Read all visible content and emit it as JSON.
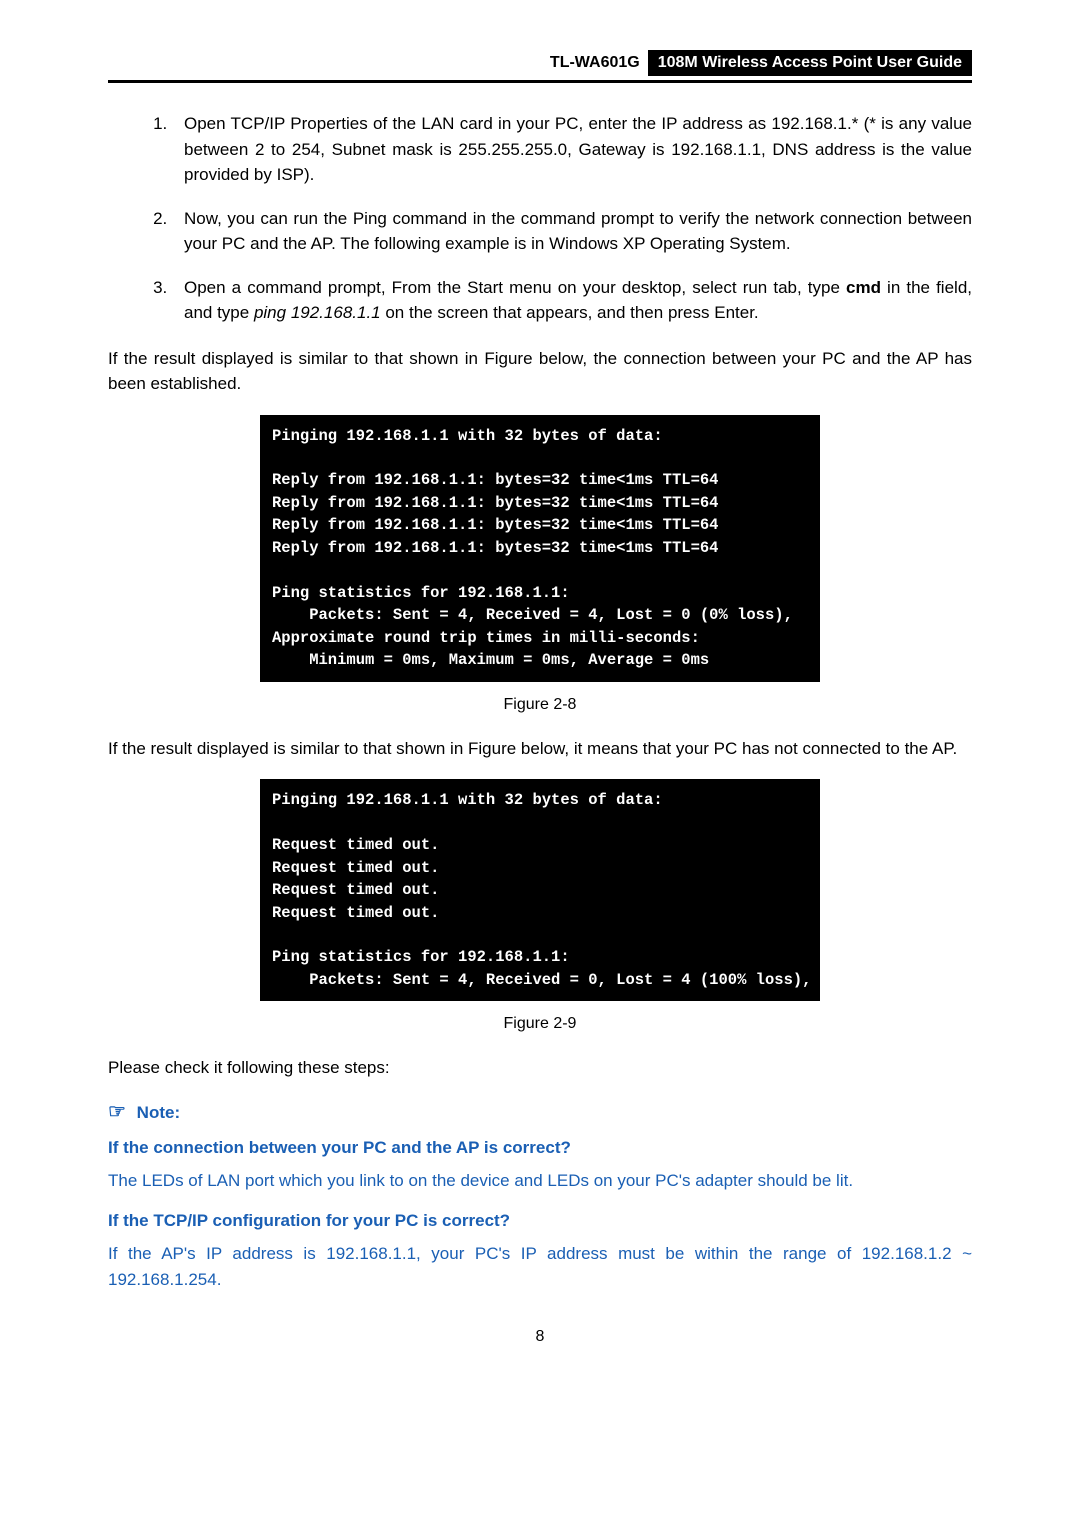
{
  "header": {
    "model": "TL-WA601G",
    "title": "108M Wireless Access Point User Guide"
  },
  "steps": {
    "s1_a": "Open TCP/IP Properties of the LAN card in your PC, enter the IP address as 192.168.1.* (* is any value between 2 to 254, Subnet mask is 255.255.255.0, Gateway is 192.168.1.1, DNS address is the value provided by ISP).",
    "s2": "Now, you can run the Ping command in the command prompt to verify the network connection between your PC and the AP. The following example is in Windows XP Operating System.",
    "s3_a": "Open a command prompt, From the Start menu on your desktop, select run tab, type ",
    "s3_cmd": "cmd",
    "s3_b": " in the field, and type ",
    "s3_ping": "ping 192.168.1.1",
    "s3_c": " on the screen that appears, and then press Enter."
  },
  "para1": "If the result displayed is similar to that shown in Figure below, the connection between your PC and the AP has been established.",
  "terminal1": "Pinging 192.168.1.1 with 32 bytes of data:\n\nReply from 192.168.1.1: bytes=32 time<1ms TTL=64\nReply from 192.168.1.1: bytes=32 time<1ms TTL=64\nReply from 192.168.1.1: bytes=32 time<1ms TTL=64\nReply from 192.168.1.1: bytes=32 time<1ms TTL=64\n\nPing statistics for 192.168.1.1:\n    Packets: Sent = 4, Received = 4, Lost = 0 (0% loss),\nApproximate round trip times in milli-seconds:\n    Minimum = 0ms, Maximum = 0ms, Average = 0ms",
  "fig1": "Figure 2-8",
  "para2": "If the result displayed is similar to that shown in Figure below, it means that your PC has not connected to the AP.",
  "terminal2": "Pinging 192.168.1.1 with 32 bytes of data:\n\nRequest timed out.\nRequest timed out.\nRequest timed out.\nRequest timed out.\n\nPing statistics for 192.168.1.1:\n    Packets: Sent = 4, Received = 0, Lost = 4 (100% loss),",
  "fig2": "Figure 2-9",
  "para3": "Please check it following these steps:",
  "note_label": "Note:",
  "q1": "If the connection between your PC and the AP is correct?",
  "a1": "The LEDs of LAN port which you link to on the device and LEDs on your PC's adapter should be lit.",
  "q2": "If the TCP/IP configuration for your PC is correct?",
  "a2": "If the AP's IP address is 192.168.1.1, your PC's IP address must be within the range of 192.168.1.2 ~ 192.168.1.254.",
  "page_number": "8"
}
